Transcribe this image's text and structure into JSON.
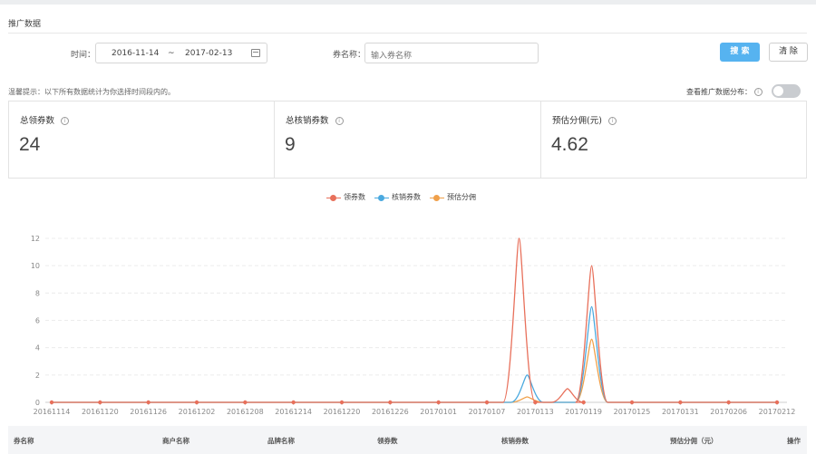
{
  "section": {
    "title": "推广数据"
  },
  "filters": {
    "time_label": "时间：",
    "start_date": "2016-11-14",
    "separator": "~",
    "end_date": "2017-02-13",
    "coupon_label": "券名称：",
    "coupon_placeholder": "输入券名称",
    "search_label": "搜 索",
    "clear_label": "清 除"
  },
  "tip": "温馨提示：以下所有数据统计为你选择时间段内的。",
  "distribution": {
    "label": "查看推广数据分布：",
    "enabled": false
  },
  "stats": [
    {
      "title": "总领券数",
      "value": "24"
    },
    {
      "title": "总核销券数",
      "value": "9"
    },
    {
      "title": "预估分佣(元)",
      "value": "4.62"
    }
  ],
  "colors": {
    "accent": "#56b3f0",
    "series_claimed": "#e8705b",
    "series_redeemed": "#4aa9df",
    "series_commission": "#f0a04a"
  },
  "chart_data": {
    "type": "line",
    "x": [
      "20161114",
      "20161120",
      "20161126",
      "20161202",
      "20161208",
      "20161214",
      "20161220",
      "20161226",
      "20170101",
      "20170107",
      "20170113",
      "20170119",
      "20170125",
      "20170131",
      "20170206",
      "20170212"
    ],
    "ylim": [
      0,
      12
    ],
    "yticks": [
      0,
      2,
      4,
      6,
      8,
      10,
      12
    ],
    "series": [
      {
        "name": "领券数",
        "peaks": [
          {
            "date": "20170111",
            "value": 12
          },
          {
            "date": "20170117",
            "value": 1
          },
          {
            "date": "20170120",
            "value": 10
          }
        ]
      },
      {
        "name": "核销券数",
        "peaks": [
          {
            "date": "20170112",
            "value": 2
          },
          {
            "date": "20170120",
            "value": 7
          }
        ]
      },
      {
        "name": "预估分佣",
        "peaks": [
          {
            "date": "20170112",
            "value": 0.4
          },
          {
            "date": "20170120",
            "value": 4.62
          }
        ]
      }
    ]
  },
  "table": {
    "columns": [
      "券名称",
      "商户名称",
      "品牌名称",
      "领券数",
      "核销券数",
      "预估分佣（元）",
      "操作"
    ]
  }
}
